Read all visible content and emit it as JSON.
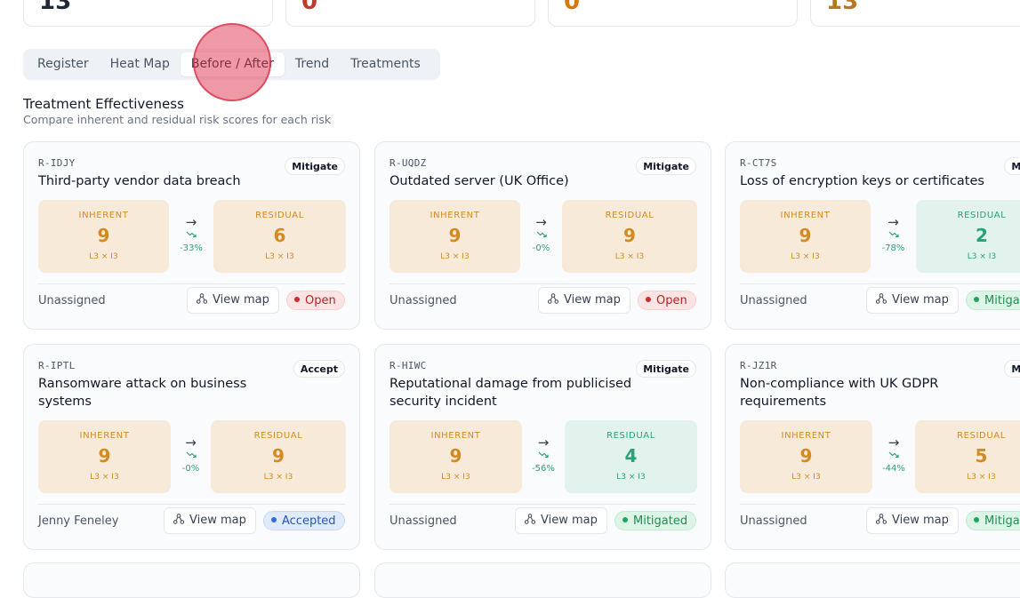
{
  "stats": [
    {
      "value": "13",
      "color": "#1f2937"
    },
    {
      "value": "0",
      "color": "#c0392b"
    },
    {
      "value": "0",
      "color": "#d97706"
    },
    {
      "value": "13",
      "color": "#b7791f"
    }
  ],
  "tabs": [
    "Register",
    "Heat Map",
    "Before / After",
    "Trend",
    "Treatments"
  ],
  "active_tab": "Before / After",
  "section": {
    "title": "Treatment Effectiveness",
    "subtitle": "Compare inherent and residual risk scores for each risk"
  },
  "labels": {
    "inherent": "INHERENT",
    "residual": "RESIDUAL",
    "view_map": "View map"
  },
  "risks": [
    {
      "id": "R-IDJY",
      "strategy": "Mitigate",
      "title": "Third-party vendor data breach",
      "inherent": {
        "score": "9",
        "lxi": "L3 × I3"
      },
      "residual": {
        "score": "6",
        "lxi": "L3 × I3",
        "tone": "warn"
      },
      "delta": "-33%",
      "owner": "Unassigned",
      "status": "Open"
    },
    {
      "id": "R-UQDZ",
      "strategy": "Mitigate",
      "title": "Outdated server (UK Office)",
      "inherent": {
        "score": "9",
        "lxi": "L3 × I3"
      },
      "residual": {
        "score": "9",
        "lxi": "L3 × I3",
        "tone": "warn"
      },
      "delta": "-0%",
      "owner": "Unassigned",
      "status": "Open"
    },
    {
      "id": "R-CT7S",
      "strategy": "Mitig",
      "title": "Loss of encryption keys or certificates",
      "inherent": {
        "score": "9",
        "lxi": "L3 × I3"
      },
      "residual": {
        "score": "2",
        "lxi": "L3 × I3",
        "tone": "good"
      },
      "delta": "-78%",
      "owner": "Unassigned",
      "status": "Mitiga"
    },
    {
      "id": "R-IPTL",
      "strategy": "Accept",
      "title": "Ransomware attack on business systems",
      "inherent": {
        "score": "9",
        "lxi": "L3 × I3"
      },
      "residual": {
        "score": "9",
        "lxi": "L3 × I3",
        "tone": "warn"
      },
      "delta": "-0%",
      "owner": "Jenny Feneley",
      "status": "Accepted"
    },
    {
      "id": "R-HIWC",
      "strategy": "Mitigate",
      "title": "Reputational damage from publicised security incident",
      "inherent": {
        "score": "9",
        "lxi": "L3 × I3"
      },
      "residual": {
        "score": "4",
        "lxi": "L3 × I3",
        "tone": "good"
      },
      "delta": "-56%",
      "owner": "Unassigned",
      "status": "Mitigated"
    },
    {
      "id": "R-JZ1R",
      "strategy": "Mitig",
      "title": "Non-compliance with UK GDPR requirements",
      "inherent": {
        "score": "9",
        "lxi": "L3 × I3"
      },
      "residual": {
        "score": "5",
        "lxi": "L3 × I3",
        "tone": "warn"
      },
      "delta": "-44%",
      "owner": "Unassigned",
      "status": "Mitiga"
    }
  ]
}
